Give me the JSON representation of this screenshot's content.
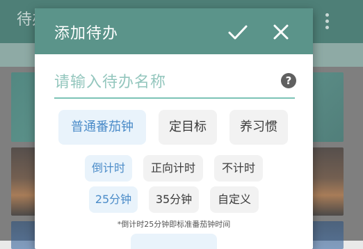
{
  "background": {
    "app_title": "待办"
  },
  "dialog": {
    "title": "添加待办",
    "name_placeholder": "请输入待办名称",
    "help_symbol": "?",
    "task_types": [
      {
        "label": "普通番茄钟",
        "selected": true
      },
      {
        "label": "定目标",
        "selected": false
      },
      {
        "label": "养习惯",
        "selected": false
      }
    ],
    "timer_modes": [
      {
        "label": "倒计时",
        "selected": true
      },
      {
        "label": "正向计时",
        "selected": false
      },
      {
        "label": "不计时",
        "selected": false
      }
    ],
    "durations": [
      {
        "label": "25分钟",
        "selected": true
      },
      {
        "label": "35分钟",
        "selected": false
      },
      {
        "label": "自定义",
        "selected": false
      }
    ],
    "hint": "*倒计时25分钟即标准番茄钟时间"
  },
  "colors": {
    "header": "#5b948a",
    "accent_underline": "#7cc3b6",
    "selected_text": "#4a8bc8",
    "selected_bg": "#e9f3fb"
  }
}
